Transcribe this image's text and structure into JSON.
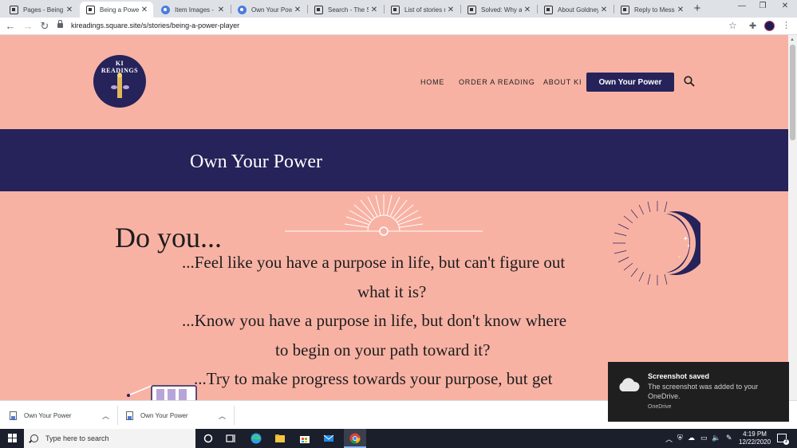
{
  "browser": {
    "tabs": [
      {
        "title": "Pages - Being a Power Player",
        "icon": "square-site-icon"
      },
      {
        "title": "Being a Power Player",
        "icon": "square-site-icon"
      },
      {
        "title": "Item Images - Cont",
        "icon": "chrome-icon"
      },
      {
        "title": "Own Your Power",
        "icon": "chrome-icon"
      },
      {
        "title": "Search - The Seller",
        "icon": "square-site-icon"
      },
      {
        "title": "List of stories not",
        "icon": "square-site-icon"
      },
      {
        "title": "Solved: Why are",
        "icon": "square-site-icon"
      },
      {
        "title": "About Goldneye",
        "icon": "square-site-icon"
      },
      {
        "title": "Reply to Message",
        "icon": "square-site-icon"
      }
    ],
    "active_tab": 1,
    "url": "kireadings.square.site/s/stories/being-a-power-player"
  },
  "site": {
    "logo": {
      "line1": "KI",
      "line2": "READINGS"
    },
    "nav": {
      "home": "HOME",
      "order": "ORDER A READING",
      "about": "ABOUT KI",
      "cta": "Own Your Power"
    },
    "banner_title": "Own Your Power",
    "heading": "Do you...",
    "lines": [
      "...Feel like you have a purpose in life, but can't figure out",
      "what it is?",
      "...Know you have a purpose in life, but don't know where",
      "to begin on your path toward it?",
      "...Try to make progress towards your purpose, but get"
    ],
    "colors": {
      "background": "#f8b2a4",
      "navy": "#26225a"
    }
  },
  "downloads": [
    {
      "name": "Own Your Power"
    },
    {
      "name": "Own Your Power"
    }
  ],
  "toast": {
    "title": "Screenshot saved",
    "message": "The screenshot was added to your OneDrive.",
    "source": "OneDrive"
  },
  "taskbar": {
    "search_placeholder": "Type here to search",
    "time": "4:19 PM",
    "date": "12/22/2020"
  }
}
